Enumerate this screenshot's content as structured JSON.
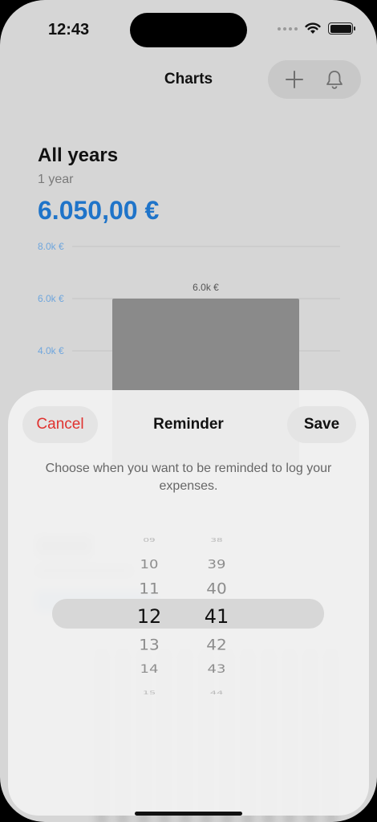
{
  "status_bar": {
    "time": "12:43"
  },
  "nav": {
    "title": "Charts"
  },
  "chart_section": {
    "title": "All years",
    "subtitle": "1 year",
    "amount": "6.050,00 €"
  },
  "chart_data": {
    "type": "bar",
    "categories": [
      ""
    ],
    "values": [
      6.0
    ],
    "value_labels": [
      "6.0k €"
    ],
    "y_ticks": [
      "8.0k €",
      "6.0k €",
      "4.0k €"
    ],
    "ylim": [
      0,
      8.0
    ],
    "grid": true,
    "bar_color": "#8a8a8a",
    "tick_color": "#6fa6dd"
  },
  "sheet": {
    "cancel_label": "Cancel",
    "title": "Reminder",
    "save_label": "Save",
    "description": "Choose when you want to be reminded to log your expenses."
  },
  "picker": {
    "hours": [
      "09",
      "10",
      "11",
      "12",
      "13",
      "14",
      "15"
    ],
    "minutes": [
      "38",
      "39",
      "40",
      "41",
      "42",
      "43",
      "44"
    ],
    "selected_hour": "12",
    "selected_minute": "41"
  },
  "colors": {
    "accent": "#1f74c9",
    "destructive": "#e0322f"
  }
}
